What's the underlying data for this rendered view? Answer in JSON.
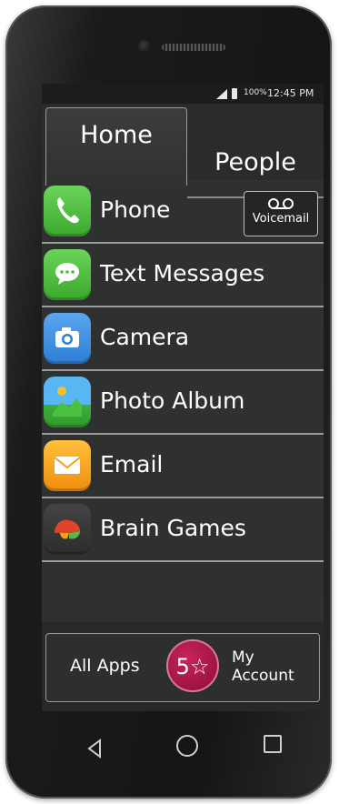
{
  "status_bar": {
    "battery": "100%",
    "time": "12:45 PM"
  },
  "tabs": [
    {
      "label": "Home",
      "selected": true
    },
    {
      "label": "People",
      "selected": false
    }
  ],
  "voicemail": {
    "label": "Voicemail",
    "icon": "voicemail-icon"
  },
  "apps": [
    {
      "label": "Phone",
      "icon": "phone-icon",
      "color": "#4cbb3a"
    },
    {
      "label": "Text Messages",
      "icon": "chat-bubble-icon",
      "color": "#4bbb3c"
    },
    {
      "label": "Camera",
      "icon": "camera-icon",
      "color": "#3d8fe0"
    },
    {
      "label": "Photo Album",
      "icon": "photo-album-icon",
      "color": "#4aa3e8"
    },
    {
      "label": "Email",
      "icon": "envelope-icon",
      "color": "#f4a21c"
    },
    {
      "label": "Brain Games",
      "icon": "brain-icon",
      "color": "#3a3a3a"
    }
  ],
  "bottom_bar": {
    "all_apps": "All Apps",
    "my_account": "My Account",
    "center_badge": "5☆"
  },
  "nav_buttons": [
    "back-icon",
    "home-icon",
    "recent-apps-icon"
  ],
  "colors": {
    "accent_badge": "#b0184e",
    "background": "#2f3030"
  }
}
